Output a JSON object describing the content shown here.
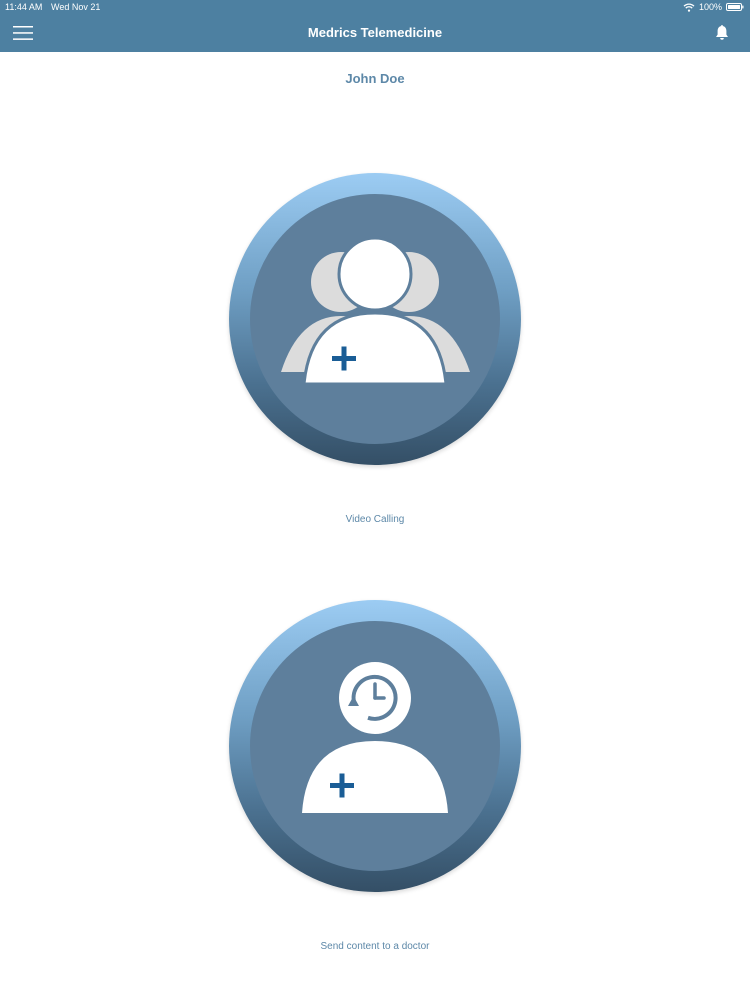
{
  "status_bar": {
    "time": "11:44 AM",
    "date": "Wed Nov 21",
    "battery": "100%"
  },
  "nav": {
    "title": "Medrics Telemedicine",
    "menu_icon": "hamburger-menu-icon",
    "bell_icon": "bell-icon"
  },
  "user": {
    "name": "John Doe"
  },
  "actions": [
    {
      "label": "Video Calling",
      "icon": "group-user-plus-icon"
    },
    {
      "label": "Send content to a doctor",
      "icon": "history-user-plus-icon"
    }
  ],
  "colors": {
    "header": "#4d80a1",
    "accent_text": "#5d88a8",
    "tile_ring_top": "#9cccf3",
    "tile_ring_bottom": "#344f66",
    "tile_inner": "#5e7f9c",
    "plus": "#1a5d96",
    "figure": "#ffffff",
    "figure_back": "#dcdcdc"
  }
}
